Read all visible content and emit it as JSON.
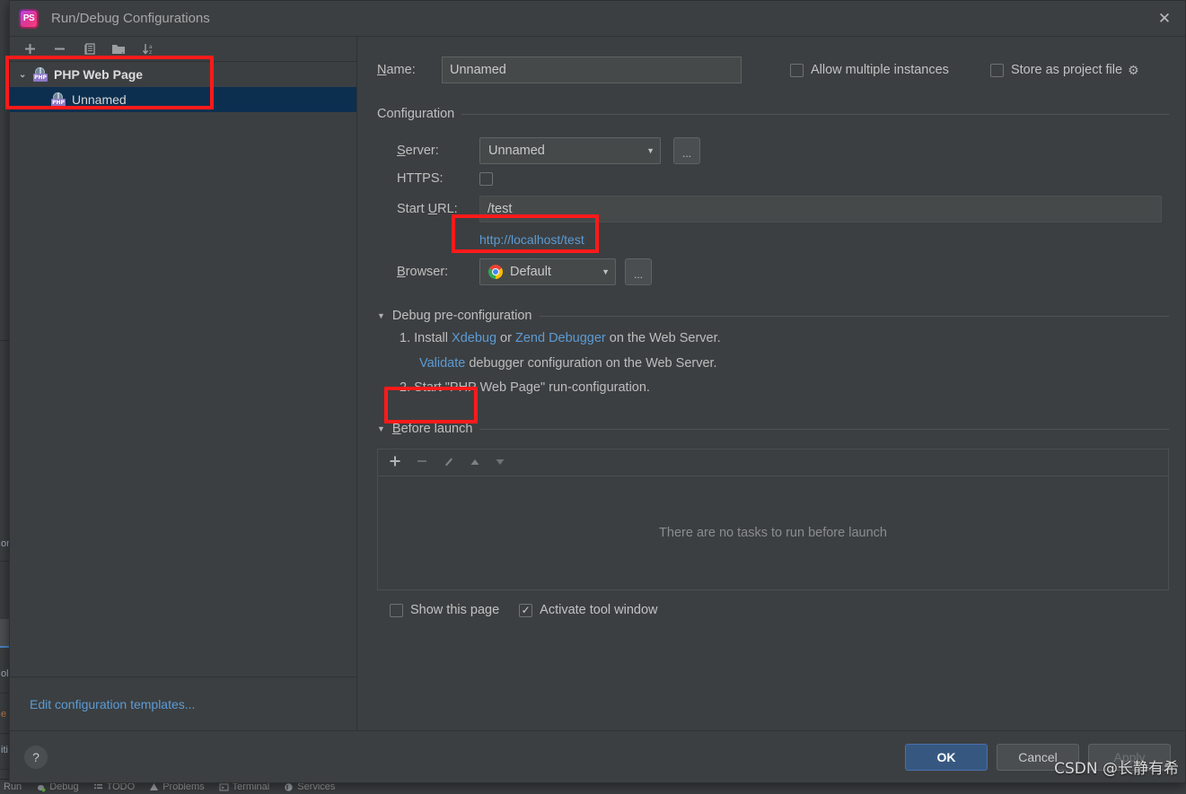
{
  "window": {
    "title": "Run/Debug Configurations",
    "app_icon": "phpstorm-logo-icon",
    "close_icon": "✕"
  },
  "sidebar": {
    "toolbar": [
      {
        "name": "add-configuration-button",
        "glyph": "+"
      },
      {
        "name": "remove-configuration-button",
        "glyph": "−"
      },
      {
        "name": "copy-configuration-button",
        "glyph": "❐"
      },
      {
        "name": "save-configuration-button",
        "glyph": "🗀"
      },
      {
        "name": "sort-configurations-button",
        "glyph": "↓a"
      }
    ],
    "tree": {
      "group_label": "PHP Web Page",
      "child_label": "Unnamed",
      "expand_chevron": "⌄",
      "icon_badge": "PHP"
    },
    "footer_link": "Edit configuration templates..."
  },
  "form": {
    "name_label": "Name:",
    "name_value": "Unnamed",
    "allow_multiple_instances": {
      "label": "Allow multiple instances",
      "checked": false
    },
    "store_as_project_file": {
      "label": "Store as project file",
      "checked": false
    },
    "gear_icon": "⚙",
    "configuration_section": "Configuration",
    "server_label": "Server:",
    "server_value": "Unnamed",
    "browse_button": "...",
    "https_label": "HTTPS:",
    "https_checked": false,
    "start_url_label": "Start URL:",
    "start_url_value": "/test",
    "resolved_url": "http://localhost/test",
    "browser_label": "Browser:",
    "browser_value": "Default",
    "browser_icon": "chrome-icon"
  },
  "debug_preconfig": {
    "title": "Debug pre-configuration",
    "step1_prefix": "1. Install ",
    "step1_link1": "Xdebug",
    "step1_mid": " or ",
    "step1_link2": "Zend Debugger",
    "step1_suffix": " on the Web Server.",
    "validate_link": "Validate",
    "validate_suffix": " debugger configuration on the Web Server.",
    "step2": "2. Start \"PHP Web Page\" run-configuration."
  },
  "before_launch": {
    "title": "Before launch",
    "toolbar": [
      {
        "name": "add-task-button",
        "glyph": "+"
      },
      {
        "name": "remove-task-button",
        "glyph": "−"
      },
      {
        "name": "edit-task-button",
        "glyph": "✎"
      },
      {
        "name": "move-task-up-button",
        "glyph": "▲"
      },
      {
        "name": "move-task-down-button",
        "glyph": "▼"
      }
    ],
    "empty_text": "There are no tasks to run before launch",
    "show_this_page": {
      "label": "Show this page",
      "checked": false
    },
    "activate_tool_window": {
      "label": "Activate tool window",
      "checked": true
    }
  },
  "footer": {
    "help_label": "?",
    "ok_label": "OK",
    "cancel_label": "Cancel",
    "apply_label": "Apply"
  },
  "ide_background": {
    "left_strip_items": [
      "on",
      "ol",
      "e",
      "iti"
    ],
    "statusbar": [
      {
        "label": "Run",
        "icon": "run-icon"
      },
      {
        "label": "Debug",
        "icon": "debug-icon"
      },
      {
        "label": "TODO",
        "icon": "todo-icon"
      },
      {
        "label": "Problems",
        "icon": "problems-icon"
      },
      {
        "label": "Terminal",
        "icon": "terminal-icon"
      },
      {
        "label": "Services",
        "icon": "services-icon"
      }
    ]
  },
  "watermark": "CSDN @长静有希",
  "colors": {
    "background": "#3c3f41",
    "input_bg": "#45494a",
    "link": "#5b9bd5",
    "selection": "#0d2f4f",
    "accent_primary": "#365880",
    "annotation": "#ff1a1a"
  }
}
